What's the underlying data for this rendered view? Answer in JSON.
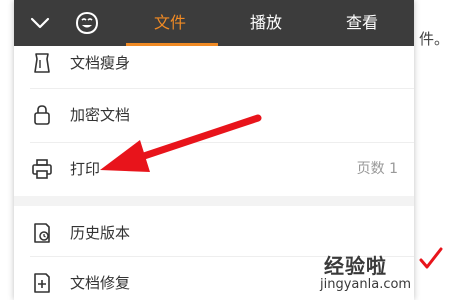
{
  "background": {
    "text_fragment": "件。"
  },
  "topbar": {
    "collapse_icon": "chevron-down-icon",
    "emoji_icon": "emoji-face-icon",
    "tabs": [
      {
        "label": "文件",
        "active": true
      },
      {
        "label": "播放",
        "active": false
      },
      {
        "label": "查看",
        "active": false
      }
    ],
    "accent_color": "#f08a24",
    "bar_color": "#3c3c3c"
  },
  "menu": {
    "items": [
      {
        "icon": "document-slim-icon",
        "label": "文档瘦身"
      },
      {
        "icon": "lock-icon",
        "label": "加密文档"
      },
      {
        "icon": "printer-icon",
        "label": "打印",
        "value": "页数 1"
      },
      {
        "icon": "history-icon",
        "label": "历史版本"
      },
      {
        "icon": "document-repair-icon",
        "label": "文档修复"
      }
    ]
  },
  "annotation": {
    "arrow_color": "#e8141b"
  },
  "watermark": {
    "text_cn": "经验啦",
    "text_en": "jingyanla.com",
    "check_color": "#e8141b"
  }
}
